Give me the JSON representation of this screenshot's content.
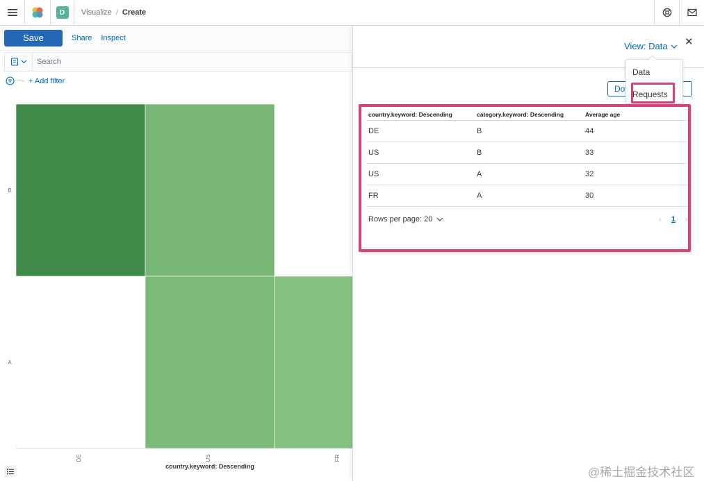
{
  "header": {
    "breadcrumb": [
      "Visualize",
      "Create"
    ],
    "space_initial": "D"
  },
  "toolbar": {
    "save_label": "Save",
    "share_label": "Share",
    "inspect_label": "Inspect"
  },
  "search": {
    "placeholder": "Search"
  },
  "filter": {
    "add_label": "+ Add filter"
  },
  "chart_data": {
    "type": "heatmap",
    "xlabel": "country.keyword: Descending",
    "ylabel": "",
    "x_categories": [
      "DE",
      "US",
      "FR"
    ],
    "y_categories": [
      "B",
      "A"
    ],
    "cells": [
      {
        "x": "DE",
        "y": "B",
        "value": 44
      },
      {
        "x": "US",
        "y": "B",
        "value": 33
      },
      {
        "x": "US",
        "y": "A",
        "value": 32
      },
      {
        "x": "FR",
        "y": "A",
        "value": 30
      }
    ],
    "colors": {
      "high": "#3f8a4a",
      "low": "#86c27f"
    }
  },
  "inspector": {
    "view_label": "View: Data",
    "view_options": [
      "Data",
      "Requests"
    ],
    "download_label": "Download CSV",
    "columns": [
      "country.keyword: Descending",
      "category.keyword: Descending",
      "Average age"
    ],
    "rows": [
      [
        "DE",
        "B",
        "44"
      ],
      [
        "US",
        "B",
        "33"
      ],
      [
        "US",
        "A",
        "32"
      ],
      [
        "FR",
        "A",
        "30"
      ]
    ],
    "rows_per_page": "Rows per page: 20",
    "current_page": "1"
  },
  "watermark": "@稀土掘金技术社区"
}
